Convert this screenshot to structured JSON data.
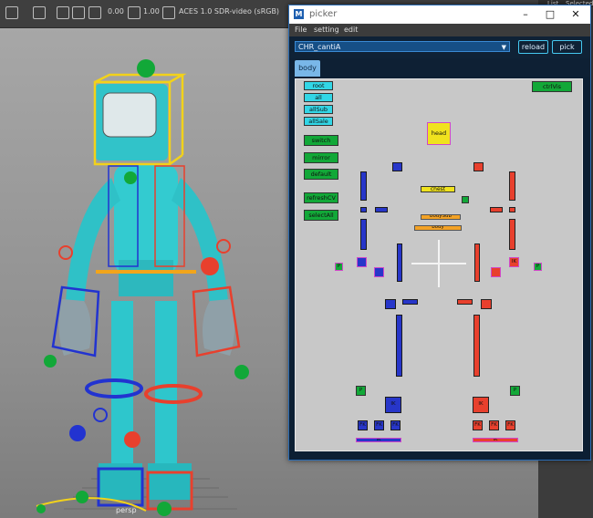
{
  "viewport": {
    "toolbar": {
      "exposure": "0.00",
      "gamma": "1.00",
      "color_space": "ACES 1.0 SDR-video (sRGB)"
    },
    "camera_label": "persp",
    "right_panel": {
      "label_1": "List",
      "label_2": "Selected"
    }
  },
  "picker": {
    "title": "picker",
    "menu": [
      "File",
      "setting",
      "edit"
    ],
    "character": "CHR_cantiA",
    "reload_label": "reload",
    "pick_label": "pick",
    "tab": "body",
    "left_buttons": [
      "root",
      "all",
      "allSub",
      "allSale"
    ],
    "action_buttons": [
      "switch",
      "mirror",
      "default",
      "refreshCV",
      "selectAll"
    ],
    "ctrlvis_label": "ctrlVis",
    "head_label": "head",
    "chest_label": "chest",
    "bodysub_label": "bodySub",
    "body_label": "body",
    "p_label": "P",
    "ik_label": "IK",
    "fk_label": "FK",
    "colors": {
      "accent": "#45c8f0",
      "left": "#2736c9",
      "right": "#e8402d",
      "ok": "#12a838"
    }
  }
}
